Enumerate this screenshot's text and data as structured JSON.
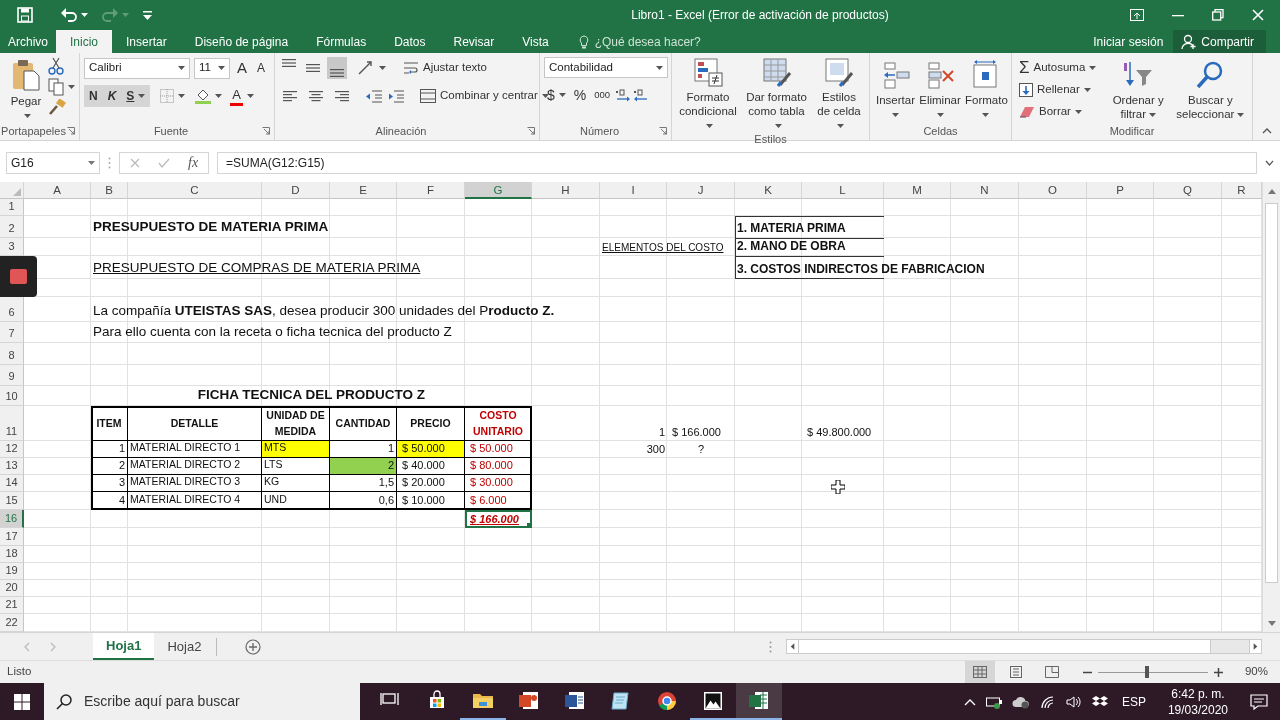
{
  "window": {
    "title": "Libro1 - Excel (Error de activación de productos)"
  },
  "tabs": [
    {
      "label": "Archivo",
      "selected": false
    },
    {
      "label": "Inicio",
      "selected": true
    },
    {
      "label": "Insertar",
      "selected": false
    },
    {
      "label": "Diseño de página",
      "selected": false
    },
    {
      "label": "Fórmulas",
      "selected": false
    },
    {
      "label": "Datos",
      "selected": false
    },
    {
      "label": "Revisar",
      "selected": false
    },
    {
      "label": "Vista",
      "selected": false
    }
  ],
  "tell_me": {
    "placeholder": "¿Qué desea hacer?"
  },
  "account": {
    "sign_in": "Iniciar sesión",
    "share": "Compartir"
  },
  "ribbon": {
    "clipboard": {
      "paste": "Pegar",
      "label": "Portapapeles"
    },
    "font": {
      "family": "Calibri",
      "size": "11",
      "grow": "A",
      "shrink": "A",
      "bold": "N",
      "italic": "K",
      "underline": "S",
      "color_label": "A",
      "label": "Fuente"
    },
    "alignment": {
      "vertical": [
        {
          "selected": false
        },
        {
          "selected": false
        },
        {
          "selected": true
        }
      ],
      "wrap": "Ajustar texto",
      "merge": "Combinar y centrar",
      "label": "Alineación"
    },
    "number": {
      "format": "Contabilidad",
      "currency": "$",
      "percent": "%",
      "thousands": "000",
      "label": "Número"
    },
    "styles": {
      "items": [
        "Formato condicional",
        "Dar formato como tabla",
        "Estilos de celda"
      ],
      "label": "Estilos"
    },
    "cells": {
      "items": [
        "Insertar",
        "Eliminar",
        "Formato"
      ],
      "label": "Celdas"
    },
    "editing": {
      "autosum_symbol": "Σ",
      "autosum": "Autosuma",
      "fill": "Rellenar",
      "clear": "Borrar",
      "sort": "Ordenar y filtrar",
      "find": "Buscar y seleccionar",
      "label": "Modificar"
    }
  },
  "formula_bar": {
    "name_box": "G16",
    "function_label": "fx",
    "formula": "=SUMA(G12:G15)"
  },
  "sheet": {
    "columns": [
      {
        "label": "A",
        "selected": false
      },
      {
        "label": "B",
        "selected": false
      },
      {
        "label": "C",
        "selected": false
      },
      {
        "label": "D",
        "selected": false
      },
      {
        "label": "E",
        "selected": false
      },
      {
        "label": "F",
        "selected": false
      },
      {
        "label": "G",
        "selected": true
      },
      {
        "label": "H",
        "selected": false
      },
      {
        "label": "I",
        "selected": false
      },
      {
        "label": "J",
        "selected": false
      },
      {
        "label": "K",
        "selected": false
      },
      {
        "label": "L",
        "selected": false
      },
      {
        "label": "M",
        "selected": false
      },
      {
        "label": "N",
        "selected": false
      },
      {
        "label": "O",
        "selected": false
      },
      {
        "label": "P",
        "selected": false
      },
      {
        "label": "Q",
        "selected": false
      },
      {
        "label": "R",
        "selected": false
      }
    ],
    "rows": [
      {
        "header": "1",
        "selected": false
      },
      {
        "header": "2",
        "selected": false,
        "cells": {
          "B": {
            "kind": "title",
            "text": "PRESUPUESTO DE MATERIA PRIMA",
            "selected": false
          },
          "K": {
            "kind": "box_item",
            "text": "1. MATERIA PRIMA",
            "selected": false
          }
        }
      },
      {
        "header": "3",
        "selected": false,
        "cells": {
          "I": {
            "kind": "note",
            "text": "ELEMENTOS DEL COSTO",
            "selected": false
          },
          "K": {
            "kind": "box_item",
            "text": "2. MANO DE OBRA",
            "selected": false
          }
        }
      },
      {
        "cells": {
          "B": {
            "kind": "subtitle",
            "text": "PRESUPUESTO DE COMPRAS DE MATERIA PRIMA",
            "selected": false
          },
          "K": {
            "kind": "box_item",
            "text": "3. COSTOS INDIRECTOS DE FABRICACION",
            "selected": false
          }
        }
      },
      {},
      {
        "header": "6",
        "selected": false,
        "cells": {
          "B": {
            "kind": "text",
            "rich": "La compañía **UTEISTAS SAS**, desea producir 300 unidades del P**roducto Z.**",
            "selected": false
          }
        }
      },
      {
        "header": "7",
        "selected": false,
        "cells": {
          "B": {
            "kind": "text",
            "text": "Para ello cuenta con la receta o ficha tecnica del producto Z",
            "selected": false
          }
        }
      },
      {
        "header": "8",
        "selected": false
      },
      {
        "header": "9",
        "selected": false
      },
      {
        "header": "10",
        "selected": false,
        "cells": {
          "B": {
            "kind": "caption",
            "text": "FICHA TECNICA DEL PRODUCTO Z",
            "selected": false
          }
        }
      },
      {
        "header": "11",
        "selected": false,
        "cells": {
          "B": {
            "kind": "header",
            "text": "ITEM",
            "selected": false
          },
          "C": {
            "kind": "header",
            "text": "DETALLE",
            "selected": false
          },
          "D": {
            "kind": "header",
            "text": "UNIDAD DE MEDIDA",
            "selected": false
          },
          "E": {
            "kind": "header",
            "text": "CANTIDAD",
            "selected": false
          },
          "F": {
            "kind": "header",
            "text": "PRECIO",
            "selected": false
          },
          "G": {
            "kind": "header",
            "text": "COSTO UNITARIO",
            "accent": true,
            "selected": false
          },
          "I": {
            "kind": "value",
            "text": "1",
            "selected": false
          },
          "J": {
            "kind": "amount",
            "symbol": "$",
            "value": "166.000",
            "selected": false
          },
          "L": {
            "kind": "amount",
            "symbol": "$",
            "value": "49.800.000",
            "selected": false
          }
        }
      },
      {
        "header": "12",
        "selected": false,
        "cells": {
          "B": {
            "kind": "number",
            "text": "1",
            "selected": false
          },
          "C": {
            "kind": "cell",
            "text": "MATERIAL DIRECTO 1",
            "selected": false
          },
          "D": {
            "kind": "cell",
            "text": "MTS",
            "color": "#ffff00",
            "selected": false
          },
          "E": {
            "kind": "number",
            "text": "1",
            "selected": false
          },
          "F": {
            "kind": "currency",
            "symbol": "$",
            "value": "50.000",
            "color": "#ffff00",
            "selected": false
          },
          "G": {
            "kind": "currency",
            "symbol": "$",
            "value": "50.000",
            "accent": true,
            "selected": false
          },
          "I": {
            "kind": "value",
            "text": "300",
            "selected": false
          },
          "J": {
            "kind": "value",
            "text": "?",
            "centered": true,
            "selected": false
          }
        }
      },
      {
        "header": "13",
        "selected": false,
        "cells": {
          "B": {
            "kind": "number",
            "text": "2",
            "selected": false
          },
          "C": {
            "kind": "cell",
            "text": "MATERIAL DIRECTO 2",
            "selected": false
          },
          "D": {
            "kind": "cell",
            "text": "LTS",
            "selected": false
          },
          "E": {
            "kind": "number",
            "text": "2",
            "color": "#92d050",
            "selected": false
          },
          "F": {
            "kind": "currency",
            "symbol": "$",
            "value": "40.000",
            "selected": false
          },
          "G": {
            "kind": "currency",
            "symbol": "$",
            "value": "80.000",
            "accent": true,
            "selected": false
          }
        }
      },
      {
        "header": "14",
        "selected": false,
        "cells": {
          "B": {
            "kind": "number",
            "text": "3",
            "selected": false
          },
          "C": {
            "kind": "cell",
            "text": "MATERIAL DIRECTO 3",
            "selected": false
          },
          "D": {
            "kind": "cell",
            "text": "KG",
            "selected": false
          },
          "E": {
            "kind": "number",
            "text": "1,5",
            "selected": false
          },
          "F": {
            "kind": "currency",
            "symbol": "$",
            "value": "20.000",
            "selected": false
          },
          "G": {
            "kind": "currency",
            "symbol": "$",
            "value": "30.000",
            "accent": true,
            "selected": false
          }
        }
      },
      {
        "header": "15",
        "selected": false,
        "cells": {
          "B": {
            "kind": "number",
            "text": "4",
            "selected": false
          },
          "C": {
            "kind": "cell",
            "text": "MATERIAL DIRECTO 4",
            "selected": false
          },
          "D": {
            "kind": "cell",
            "text": "UND",
            "selected": false
          },
          "E": {
            "kind": "number",
            "text": "0,6",
            "selected": false
          },
          "F": {
            "kind": "currency",
            "symbol": "$",
            "value": "10.000",
            "selected": false
          },
          "G": {
            "kind": "currency",
            "symbol": "$",
            "value": "6.000",
            "accent": true,
            "selected": false
          }
        }
      },
      {
        "header": "16",
        "selected": true,
        "cells": {
          "G": {
            "kind": "total",
            "symbol": "$",
            "value": "166.000",
            "accent": true,
            "selected": true
          }
        }
      },
      {
        "header": "17",
        "selected": false
      },
      {
        "header": "18",
        "selected": false
      },
      {
        "header": "19",
        "selected": false
      },
      {
        "header": "20",
        "selected": false
      },
      {
        "header": "21",
        "selected": false
      },
      {
        "header": "22",
        "selected": false
      }
    ]
  },
  "sheet_tabs": [
    {
      "label": "Hoja1",
      "selected": true
    },
    {
      "label": "Hoja2",
      "selected": false
    }
  ],
  "status_bar": {
    "status": "Listo",
    "views": [
      {
        "selected": true
      },
      {
        "selected": false
      },
      {
        "selected": false
      }
    ],
    "zoom": {
      "level": 0.45,
      "label": "90%"
    }
  },
  "taskbar": {
    "search_placeholder": "Escribe aquí para buscar",
    "apps": [
      {
        "running": false,
        "selected": false
      },
      {
        "running": false,
        "selected": false
      },
      {
        "running": true,
        "selected": false
      },
      {
        "running": false,
        "selected": false
      },
      {
        "running": false,
        "selected": false
      },
      {
        "running": false,
        "selected": false
      },
      {
        "running": false,
        "selected": false
      },
      {
        "running": true,
        "selected": false
      },
      {
        "running": true,
        "selected": true
      }
    ],
    "language": "ESP",
    "time": "6:42 p. m.",
    "date": "19/03/2020"
  }
}
